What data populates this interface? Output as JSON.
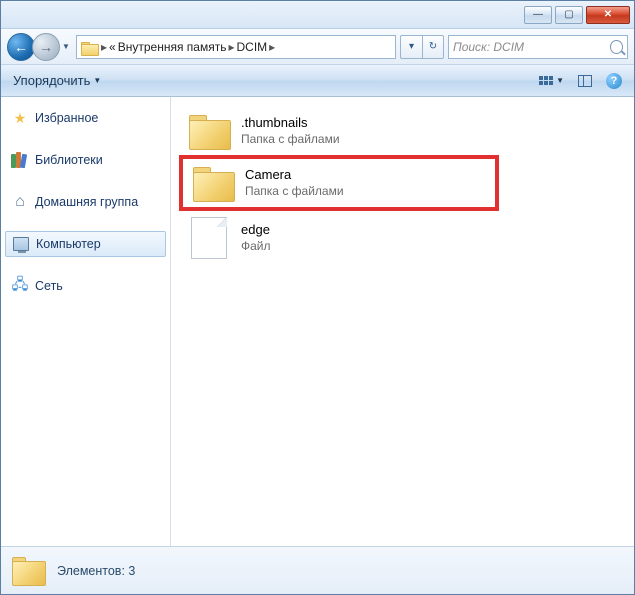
{
  "titlebar": {
    "min": "—",
    "max": "▢",
    "close": "✕"
  },
  "breadcrumb": {
    "prefix": "«",
    "parts": [
      "Внутренняя память",
      "DCIM"
    ]
  },
  "search": {
    "placeholder": "Поиск: DCIM"
  },
  "toolbar": {
    "organize": "Упорядочить"
  },
  "sidebar": {
    "favorites": "Избранное",
    "libraries": "Библиотеки",
    "homegroup": "Домашняя группа",
    "computer": "Компьютер",
    "network": "Сеть"
  },
  "items": [
    {
      "name": ".thumbnails",
      "type": "Папка с файлами",
      "kind": "folder",
      "highlight": false
    },
    {
      "name": "Camera",
      "type": "Папка с файлами",
      "kind": "folder",
      "highlight": true
    },
    {
      "name": "edge",
      "type": "Файл",
      "kind": "file",
      "highlight": false
    }
  ],
  "status": {
    "text": "Элементов: 3"
  }
}
